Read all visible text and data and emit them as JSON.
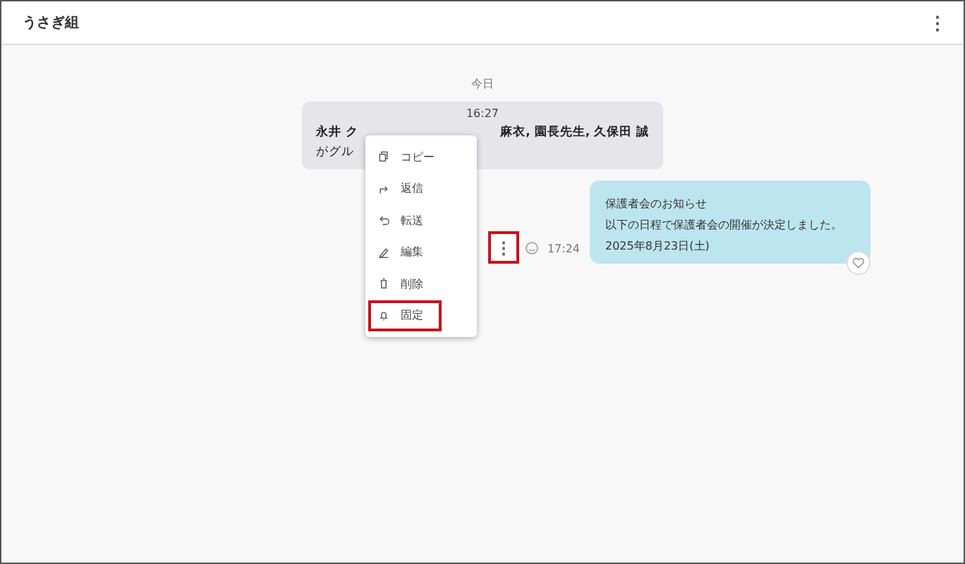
{
  "header": {
    "title": "うさぎ組",
    "menu_icon": "⋮"
  },
  "date_divider": "今日",
  "system_message": {
    "time": "16:27",
    "line_1_start": "永井 ク",
    "line_1_end": "麻衣, 園長先生, 久保田 誠",
    "line_2": "がグル"
  },
  "context_menu": [
    {
      "kind": "copy",
      "label": "コピー",
      "highlighted": false
    },
    {
      "kind": "reply",
      "label": "返信",
      "highlighted": false
    },
    {
      "kind": "forward",
      "label": "転送",
      "highlighted": false
    },
    {
      "kind": "edit",
      "label": "編集",
      "highlighted": false
    },
    {
      "kind": "delete",
      "label": "削除",
      "highlighted": false
    },
    {
      "kind": "pin",
      "label": "固定",
      "highlighted": true
    }
  ],
  "message": {
    "more_button": "⋮",
    "more_highlighted": true,
    "time": "17:24",
    "lines": [
      "保護者会のお知らせ",
      "以下の日程で保護者会の開催が決定しました。",
      "2025年8月23日(土)"
    ]
  }
}
